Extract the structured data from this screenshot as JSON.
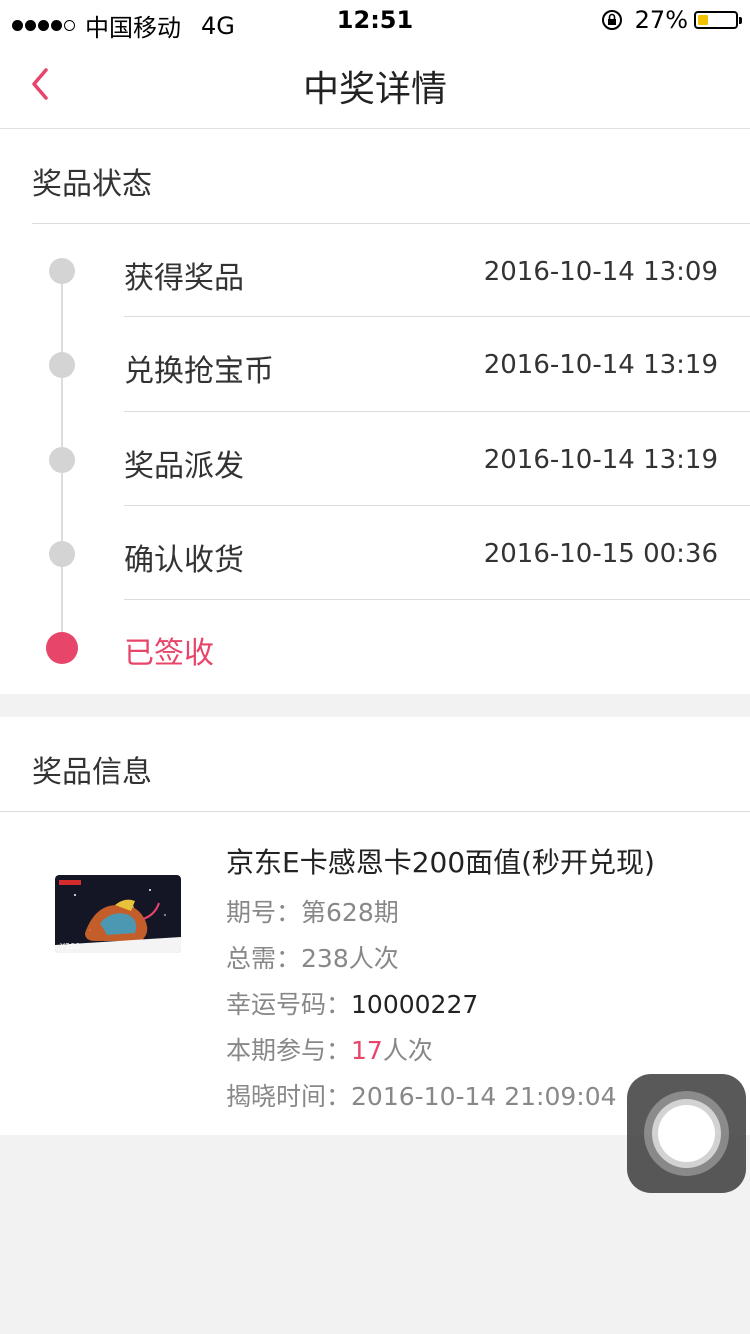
{
  "status_bar": {
    "carrier": "中国移动",
    "network": "4G",
    "time": "12:51",
    "battery": "27%",
    "battery_level": 0.27
  },
  "nav": {
    "title": "中奖详情",
    "back_icon": "chevron-left-icon"
  },
  "prize_status": {
    "title": "奖品状态",
    "steps": [
      {
        "label": "获得奖品",
        "time": "2016-10-14 13:09"
      },
      {
        "label": "兑换抢宝币",
        "time": "2016-10-14 13:19"
      },
      {
        "label": "奖品派发",
        "time": "2016-10-14 13:19"
      },
      {
        "label": "确认收货",
        "time": "2016-10-15 00:36"
      },
      {
        "label": "已签收",
        "time": ""
      }
    ]
  },
  "prize_info": {
    "title": "奖品信息",
    "image_value": "¥200",
    "name": "京东E卡感恩卡200面值(秒开兑现)",
    "period_label": "期号：",
    "period_value": "第628期",
    "total_label": "总需：",
    "total_value": "238人次",
    "lucky_label": "幸运号码：",
    "lucky_value": "10000227",
    "joined_label": "本期参与：",
    "joined_count": "17",
    "joined_unit": "人次",
    "reveal_label": "揭晓时间：",
    "reveal_value": "2016-10-14 21:09:04"
  },
  "colors": {
    "accent": "#e8456a",
    "dot_inactive": "#d4d4d4"
  }
}
